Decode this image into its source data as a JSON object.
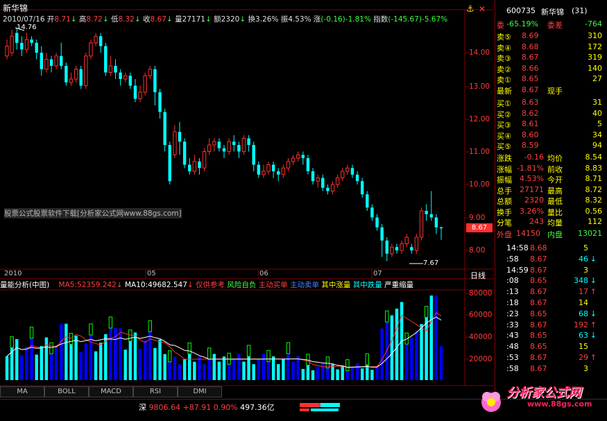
{
  "price_panel": {
    "title": "新华锦",
    "date": "2010/07/16",
    "open_label": "开",
    "open": "8.71",
    "high_label": "高",
    "high": "8.72",
    "low_label": "低",
    "low": "8.32",
    "close_label": "收",
    "close": "8.67",
    "volume_label": "量",
    "volume": "27171",
    "amount_label": "额",
    "amount": "2320",
    "turnover_label": "换",
    "turnover": "3.26%",
    "amplitude_label": "振",
    "amplitude": "4.53%",
    "change_label": "涨",
    "change": "(-0.16)-1.81%",
    "index_label": "指数",
    "index": "(-145.67)-5.67%",
    "high_marker": "14.76",
    "low_marker": "7.67",
    "price_tag": "8.67",
    "watermark": "股票公式股票软件下载[分析家公式网www.88gs.com]",
    "y_ticks": [
      "14.00",
      "13.00",
      "12.00",
      "11.00",
      "10.00",
      "9.00",
      "8.00"
    ],
    "x_labels": [
      "2010",
      "05",
      "06",
      "07"
    ],
    "period": "日线"
  },
  "volume_panel": {
    "title": "量能分析",
    "subtitle": "(中图)",
    "ma5_label": "MA5:52359.242",
    "ma10_label": "MA10:49682.547",
    "notes": [
      "仅供参考",
      "风险自负",
      "主动买单",
      "主动卖单",
      "其中涨量",
      "其中跌量",
      "严重缩量"
    ],
    "y_ticks": [
      "80000",
      "60000",
      "40000",
      "20000"
    ]
  },
  "tabs": [
    "MA",
    "BOLL",
    "MACD",
    "RSI",
    "DMI"
  ],
  "status": {
    "market": "深",
    "index": "9806.64",
    "change": "+87.91",
    "pct": "0.90%",
    "amount": "497.36亿"
  },
  "right_panel": {
    "code": "600735",
    "name": "新华锦",
    "count": "(31)",
    "weibi_label": "委",
    "weibi": "-65.19%",
    "weicha_label": "委差",
    "weicha": "-764",
    "asks": [
      {
        "label": "卖⑤",
        "price": "8.69",
        "vol": "310"
      },
      {
        "label": "卖④",
        "price": "8.68",
        "vol": "172"
      },
      {
        "label": "卖③",
        "price": "8.67",
        "vol": "319"
      },
      {
        "label": "卖②",
        "price": "8.66",
        "vol": "140"
      },
      {
        "label": "卖①",
        "price": "8.65",
        "vol": "27"
      }
    ],
    "last_label": "最新",
    "last": "8.67",
    "hand_label": "现手",
    "bids": [
      {
        "label": "买①",
        "price": "8.63",
        "vol": "31"
      },
      {
        "label": "买②",
        "price": "8.62",
        "vol": "40"
      },
      {
        "label": "买③",
        "price": "8.61",
        "vol": "5"
      },
      {
        "label": "买④",
        "price": "8.60",
        "vol": "34"
      },
      {
        "label": "买⑤",
        "price": "8.59",
        "vol": "94"
      }
    ],
    "stats": [
      {
        "l1": "涨跌",
        "v1": "-0.16",
        "l2": "均价",
        "v2": "8.54"
      },
      {
        "l1": "涨幅",
        "v1": "-1.81%",
        "l2": "前收",
        "v2": "8.83"
      },
      {
        "l1": "振幅",
        "v1": "4.53%",
        "l2": "今开",
        "v2": "8.71"
      },
      {
        "l1": "总手",
        "v1": "27171",
        "l2": "最高",
        "v2": "8.72"
      },
      {
        "l1": "总额",
        "v1": "2320",
        "l2": "最低",
        "v2": "8.32"
      },
      {
        "l1": "换手",
        "v1": "3.26%",
        "l2": "量比",
        "v2": "0.56"
      },
      {
        "l1": "分笔",
        "v1": "243",
        "l2": "均量",
        "v2": "112"
      }
    ],
    "outer_label": "外盘",
    "outer": "14150",
    "inner_label": "内盘",
    "inner": "13021",
    "ticks": [
      {
        "time": "14:58",
        "price": "8.68",
        "vol": "5",
        "dir": ""
      },
      {
        "time": ":58",
        "price": "8.67",
        "vol": "46",
        "dir": "↓"
      },
      {
        "time": "14:59",
        "price": "8.67",
        "vol": "3",
        "dir": ""
      },
      {
        "time": ":08",
        "price": "8.65",
        "vol": "348",
        "dir": "↓"
      },
      {
        "time": ":13",
        "price": "8.67",
        "vol": "17",
        "dir": "↑"
      },
      {
        "time": ":18",
        "price": "8.67",
        "vol": "14",
        "dir": ""
      },
      {
        "time": ":23",
        "price": "8.65",
        "vol": "68",
        "dir": "↓"
      },
      {
        "time": ":33",
        "price": "8.67",
        "vol": "192",
        "dir": "↑"
      },
      {
        "time": ":43",
        "price": "8.65",
        "vol": "63",
        "dir": "↓"
      },
      {
        "time": ":48",
        "price": "8.65",
        "vol": "15",
        "dir": ""
      },
      {
        "time": ":53",
        "price": "8.67",
        "vol": "29",
        "dir": "↑"
      },
      {
        "time": ":58",
        "price": "8.67",
        "vol": "3",
        "dir": ""
      }
    ]
  },
  "logo": "分析家公式网",
  "logo_url": "www.88gs.com",
  "colors": {
    "up": "#ff3030",
    "down": "#00ffff",
    "grid": "#800000",
    "vol_yellow": "#ffff00",
    "vol_blue": "#0000ff"
  }
}
